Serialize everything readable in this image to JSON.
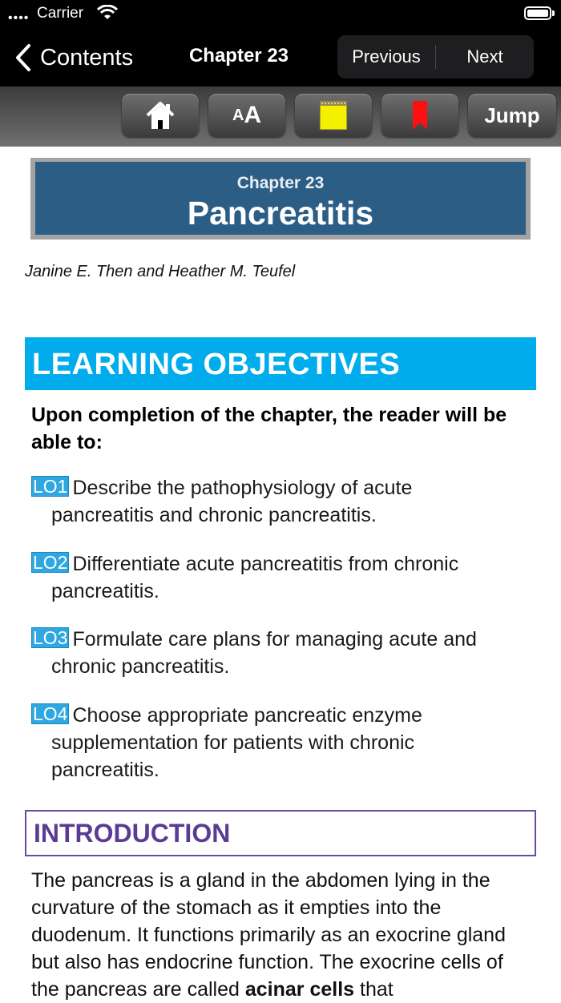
{
  "status_bar": {
    "carrier": "Carrier"
  },
  "nav": {
    "back_label": "Contents",
    "title": "Chapter 23",
    "previous_label": "Previous",
    "next_label": "Next"
  },
  "toolbar": {
    "home_icon": "home-icon",
    "font_size_label_small": "A",
    "font_size_label_big": "A",
    "note_icon": "sticky-note-icon",
    "bookmark_icon": "bookmark-icon",
    "jump_label": "Jump"
  },
  "chapter": {
    "number": "Chapter 23",
    "title": "Pancreatitis",
    "authors": "Janine E. Then and Heather M. Teufel"
  },
  "learning_objectives": {
    "heading": "LEARNING OBJECTIVES",
    "intro": "Upon completion of the chapter, the reader will be able to:",
    "items": [
      {
        "tag": "LO1",
        "first": "Describe the pathophysiology of acute",
        "rest": [
          "pancreatitis and chronic pancreatitis."
        ]
      },
      {
        "tag": "LO2",
        "first": "Differentiate acute pancreatitis from chronic",
        "rest": [
          "pancreatitis."
        ]
      },
      {
        "tag": "LO3",
        "first": "Formulate care plans for managing acute and",
        "rest": [
          "chronic pancreatitis."
        ]
      },
      {
        "tag": "LO4",
        "first": "Choose appropriate pancreatic enzyme",
        "rest": [
          "supplementation for patients with chronic",
          "pancreatitis."
        ]
      }
    ]
  },
  "introduction": {
    "heading": "INTRODUCTION",
    "text_before_bold": "The pancreas is a gland in the abdomen lying in the curvature of the stomach as it empties into the duodenum. It functions primarily as an exocrine gland but also has endocrine function. The exocrine cells of the pancreas are called ",
    "bold": "acinar cells",
    "text_after_bold": " that"
  },
  "colors": {
    "lo_header_bg": "#00acec",
    "banner_bg": "#2c5d85",
    "intro_accent": "#5b3b93",
    "lo_tag_bg": "#2fa7e0"
  }
}
